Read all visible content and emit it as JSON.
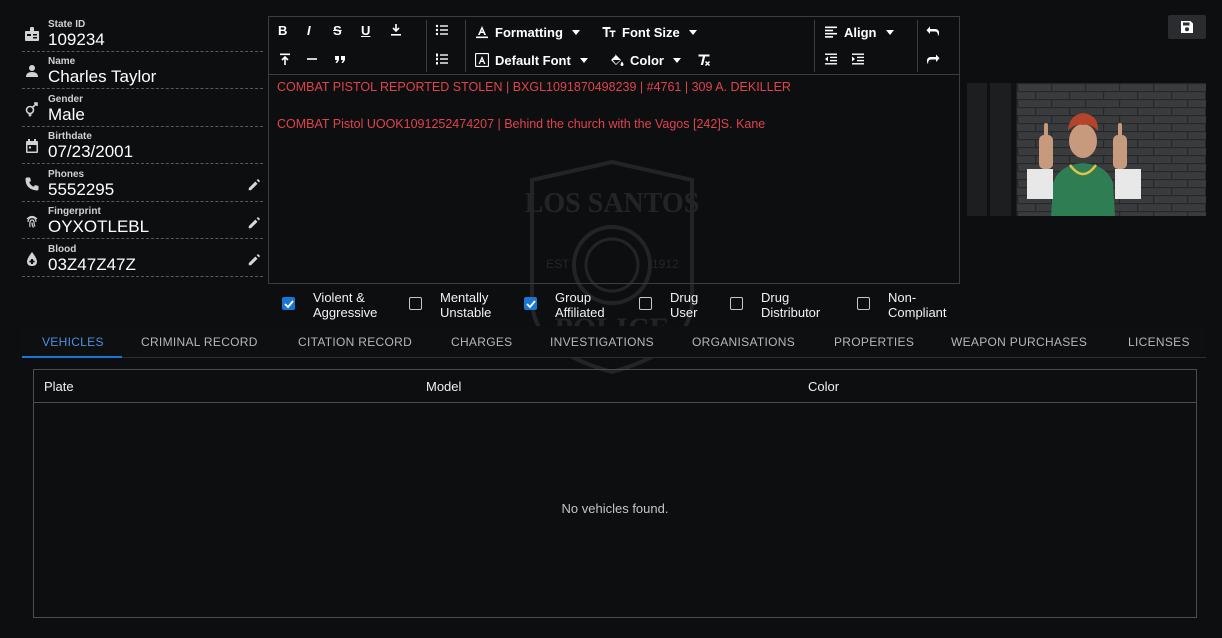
{
  "profile": {
    "state_id": {
      "label": "State ID",
      "value": "109234"
    },
    "name": {
      "label": "Name",
      "value": "Charles Taylor"
    },
    "gender": {
      "label": "Gender",
      "value": "Male"
    },
    "birthdate": {
      "label": "Birthdate",
      "value": "07/23/2001"
    },
    "phones": {
      "label": "Phones",
      "value": "5552295"
    },
    "fingerprint": {
      "label": "Fingerprint",
      "value": "OYXOTLEBL"
    },
    "blood": {
      "label": "Blood",
      "value": "03Z47Z47Z"
    }
  },
  "toolbar": {
    "formatting_label": "Formatting",
    "font_size_label": "Font Size",
    "align_label": "Align",
    "font_label": "Default Font",
    "color_label": "Color",
    "bold_glyph": "B",
    "italic_glyph": "I",
    "strike_glyph": "S",
    "underline_glyph": "U"
  },
  "notes": [
    "COMBAT PISTOL REPORTED STOLEN | BXGL1091870498239 | #4761 | 309 A. DEKILLER",
    "COMBAT Pistol UOOK1091252474207 | Behind the church with the Vagos [242]S. Kane"
  ],
  "notes_color": "#e0434c",
  "flags": [
    {
      "label": "Violent &\nAggressive",
      "checked": true
    },
    {
      "label": "Mentally\nUnstable",
      "checked": false
    },
    {
      "label": "Group\nAffiliated",
      "checked": true
    },
    {
      "label": "Drug\nUser",
      "checked": false
    },
    {
      "label": "Drug\nDistributor",
      "checked": false
    },
    {
      "label": "Non-\nCompliant",
      "checked": false
    }
  ],
  "tabs": [
    "VEHICLES",
    "CRIMINAL RECORD",
    "CITATION RECORD",
    "CHARGES",
    "INVESTIGATIONS",
    "ORGANISATIONS",
    "PROPERTIES",
    "WEAPON PURCHASES",
    "LICENSES"
  ],
  "active_tab": "VEHICLES",
  "accent_color": "#1976d2",
  "vehicles_table": {
    "columns": [
      "Plate",
      "Model",
      "Color"
    ],
    "rows": [],
    "empty_message": "No vehicles found."
  },
  "watermark": {
    "text_top": "LOS SANTOS",
    "text_bottom": "POLICE",
    "left_text": "EST",
    "right_text": "1912"
  }
}
